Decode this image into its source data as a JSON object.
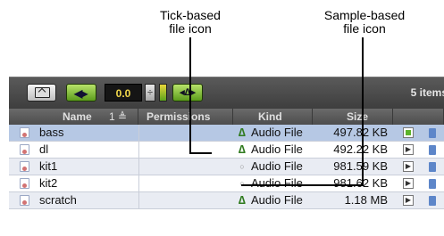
{
  "annotations": {
    "tick_based": {
      "line1": "Tick-based",
      "line2": "file icon"
    },
    "sample_based": {
      "line1": "Sample-based",
      "line2": "file icon"
    }
  },
  "toolbar": {
    "folder_icon": "folder-up-icon",
    "play_icon": "speaker-play-icon",
    "volume_value": "0.0",
    "stepper_icon": "stepper-icon",
    "meter_icon": "level-meter-icon",
    "mode_label": "◂∆▸",
    "item_count": "5 items"
  },
  "table": {
    "headers": {
      "name": "Name",
      "sort": "1 ≜",
      "permissions": "Permissions",
      "kind": "Kind",
      "size": "Size"
    },
    "rows": [
      {
        "name": "bass",
        "permissions": "",
        "kind_icon": "tick",
        "kind_glyph": "∆",
        "kind": "Audio File",
        "size": "497.82 KB",
        "status": "green-square",
        "status_glyph": ""
      },
      {
        "name": "dl",
        "permissions": "",
        "kind_icon": "tick",
        "kind_glyph": "∆",
        "kind": "Audio File",
        "size": "492.22 KB",
        "status": "play",
        "status_glyph": "▶"
      },
      {
        "name": "kit1",
        "permissions": "",
        "kind_icon": "sample",
        "kind_glyph": "○",
        "kind": "Audio File",
        "size": "981.59 KB",
        "status": "play",
        "status_glyph": "▶"
      },
      {
        "name": "kit2",
        "permissions": "",
        "kind_icon": "sample",
        "kind_glyph": "○",
        "kind": "Audio File",
        "size": "981.62 KB",
        "status": "play",
        "status_glyph": "▶"
      },
      {
        "name": "scratch",
        "permissions": "",
        "kind_icon": "tick",
        "kind_glyph": "∆",
        "kind": "Audio File",
        "size": "1.18 MB",
        "status": "play",
        "status_glyph": "▶"
      }
    ]
  },
  "colors": {
    "toolbar_bg": "#4a4a4a",
    "accent_green": "#8bc34a",
    "selected_row": "#b6c8e4",
    "alt_row": "#e9ecf3",
    "volume_text": "#f2d84b"
  }
}
